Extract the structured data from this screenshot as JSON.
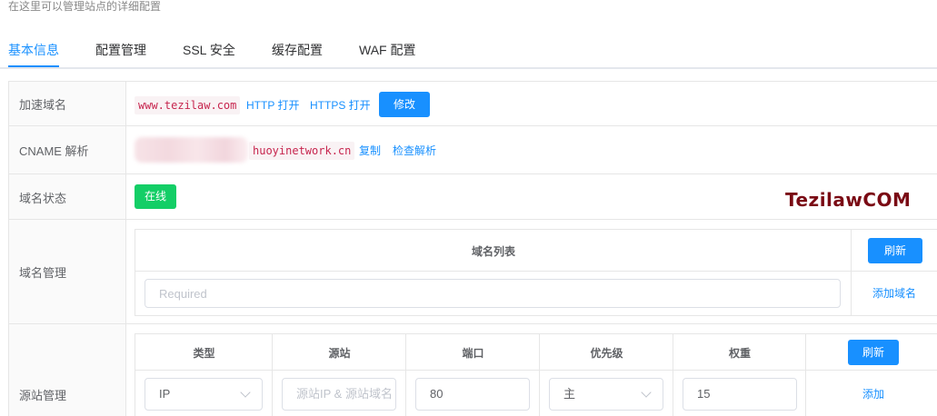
{
  "header": {
    "subtitle": "在这里可以管理站点的详细配置"
  },
  "tabs": [
    {
      "label": "基本信息",
      "active": true
    },
    {
      "label": "配置管理",
      "active": false
    },
    {
      "label": "SSL 安全",
      "active": false
    },
    {
      "label": "缓存配置",
      "active": false
    },
    {
      "label": "WAF 配置",
      "active": false
    }
  ],
  "rows": {
    "domain": {
      "label": "加速域名",
      "value": "www.tezilaw.com",
      "http_link": "HTTP 打开",
      "https_link": "HTTPS 打开",
      "edit_button": "修改"
    },
    "cname": {
      "label": "CNAME 解析",
      "value": "huoyinetwork.cn",
      "copy_link": "复制",
      "check_link": "检查解析"
    },
    "status": {
      "label": "域名状态",
      "badge": "在线"
    },
    "domain_mgmt": {
      "label": "域名管理",
      "table_header": "域名列表",
      "refresh_button": "刷新",
      "input_placeholder": "Required",
      "add_link": "添加域名"
    },
    "origin_mgmt": {
      "label": "源站管理",
      "headers": [
        "类型",
        "源站",
        "端口",
        "优先级",
        "权重"
      ],
      "refresh_button": "刷新",
      "type_value": "IP",
      "origin_placeholder": "源站IP & 源站域名",
      "port_value": "80",
      "priority_value": "主",
      "weight_value": "15",
      "add_link": "添加"
    }
  },
  "watermark": "TezilawCOM",
  "colors": {
    "primary": "#1890ff",
    "success": "#13ce66",
    "code_text": "#c7254e",
    "watermark": "#7a0a14"
  }
}
